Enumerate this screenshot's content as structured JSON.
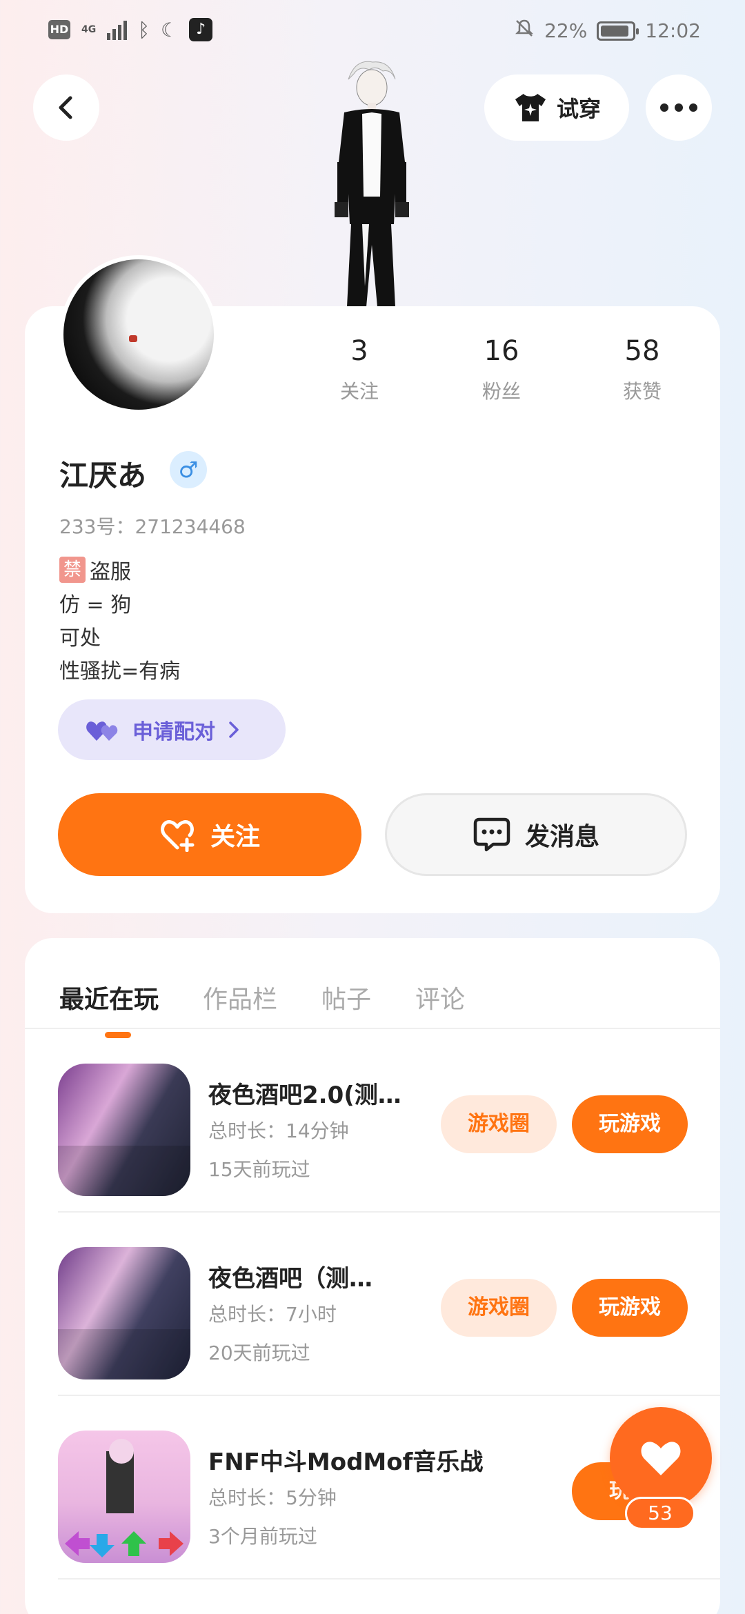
{
  "status_bar": {
    "hd": "HD",
    "network": "4G",
    "battery": "22%",
    "time": "12:02"
  },
  "header": {
    "tryon_label": "试穿"
  },
  "profile": {
    "stats": [
      {
        "num": "3",
        "label": "关注"
      },
      {
        "num": "16",
        "label": "粉丝"
      },
      {
        "num": "58",
        "label": "获赞"
      }
    ],
    "username": "江厌あ",
    "gender_symbol": "♂",
    "uid": "233号：271234468",
    "bio": [
      "盗服",
      "仿 = 狗",
      "可处",
      "性骚扰=有病"
    ],
    "ban_badge": "禁",
    "pair_label": "申请配对",
    "follow_label": "关注",
    "message_label": "发消息"
  },
  "tabs": [
    "最近在玩",
    "作品栏",
    "帖子",
    "评论"
  ],
  "games": [
    {
      "title": "夜色酒吧2.0(测…",
      "duration": "总时长：14分钟",
      "last_played": "15天前玩过",
      "circle_label": "游戏圈",
      "play_label": "玩游戏"
    },
    {
      "title": "夜色酒吧（测…",
      "duration": "总时长：7小时",
      "last_played": "20天前玩过",
      "circle_label": "游戏圈",
      "play_label": "玩游戏"
    },
    {
      "title": "FNF中斗ModMof音乐战",
      "duration": "总时长：5分钟",
      "last_played": "3个月前玩过",
      "play_label": "玩游"
    }
  ],
  "like_fab": {
    "count": "53"
  },
  "colors": {
    "accent": "#ff7412",
    "pair_bg": "#e8e6fa",
    "pair_text": "#6a5fd8"
  }
}
